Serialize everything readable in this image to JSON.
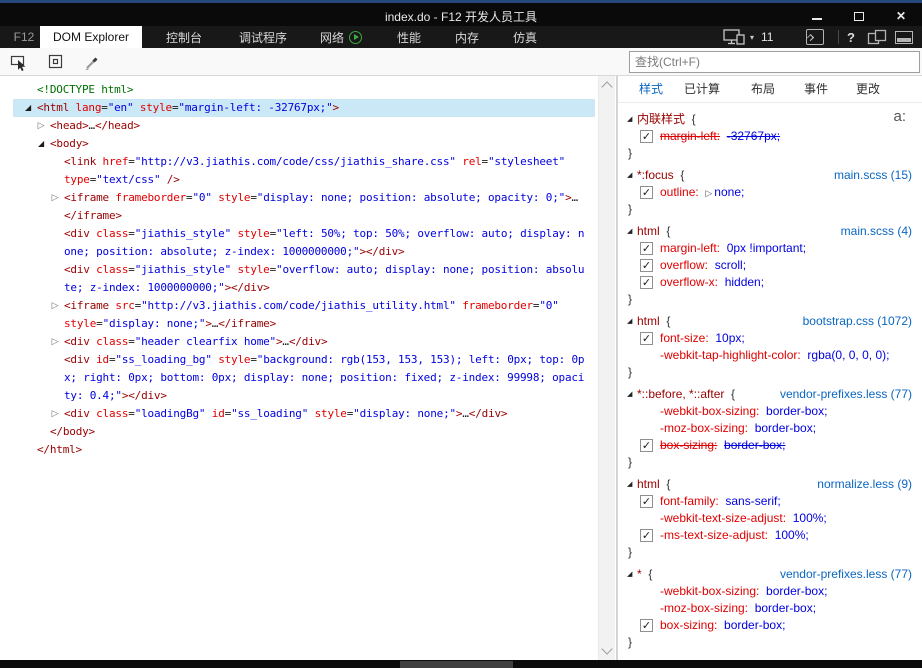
{
  "colors": {
    "accent_top_strip": "#26497c",
    "titlebar_bg": "#0a0a0a",
    "selection_bg": "#cbe8f6",
    "tag_color": "#990000",
    "attr_color": "#e00000",
    "value_color": "#0000e0",
    "doctype_color": "#007000",
    "link_color": "#0a66c2"
  },
  "icons": {
    "close": "✕",
    "help": "?",
    "doc_mode_caret": "▾",
    "tree_expanded": "◢",
    "tree_collapsed": "▷",
    "rule_expanded": "◢",
    "value_expander": "▷",
    "checkbox_check": "✓"
  },
  "window": {
    "title": "index.do - F12 开发人员工具"
  },
  "tab_bar": {
    "f12_label": "F12",
    "doc_mode": "11",
    "tabs": [
      {
        "name": "dom-explorer",
        "label": "DOM Explorer",
        "active": true
      },
      {
        "name": "console",
        "label": "控制台"
      },
      {
        "name": "debugger",
        "label": "调试程序"
      },
      {
        "name": "network",
        "label": "网络",
        "play_icon": true
      },
      {
        "name": "performance",
        "label": "性能"
      },
      {
        "name": "memory",
        "label": "内存"
      },
      {
        "name": "emulation",
        "label": "仿真"
      }
    ]
  },
  "toolbar": {
    "search_placeholder": "查找(Ctrl+F)"
  },
  "dom_tree": {
    "lines": [
      {
        "level": 0,
        "marker": null,
        "tokens": [
          [
            "d",
            "<!DOCTYPE html>"
          ]
        ]
      },
      {
        "level": 0,
        "marker": "exp",
        "selected": true,
        "tokens": [
          [
            "t",
            "<html "
          ],
          [
            "a",
            "lang"
          ],
          [
            "p",
            "="
          ],
          [
            "v",
            "\"en\""
          ],
          [
            "p",
            " "
          ],
          [
            "a",
            "style"
          ],
          [
            "p",
            "="
          ],
          [
            "v",
            "\"margin-left: -32767px;\""
          ],
          [
            "t",
            ">"
          ]
        ]
      },
      {
        "level": 1,
        "marker": "col",
        "tokens": [
          [
            "t",
            "<head>"
          ],
          [
            "p",
            "…"
          ],
          [
            "t",
            "</head>"
          ]
        ]
      },
      {
        "level": 1,
        "marker": "exp",
        "tokens": [
          [
            "t",
            "<body>"
          ]
        ]
      },
      {
        "level": 2,
        "marker": null,
        "tokens": [
          [
            "t",
            "<link "
          ],
          [
            "a",
            "href"
          ],
          [
            "p",
            "="
          ],
          [
            "v",
            "\"http://v3.jiathis.com/code/css/jiathis_share.css\""
          ],
          [
            "p",
            " "
          ],
          [
            "a",
            "rel"
          ],
          [
            "p",
            "="
          ],
          [
            "v",
            "\"stylesheet\""
          ]
        ]
      },
      {
        "level": 2,
        "marker": null,
        "tokens": [
          [
            "a",
            "type"
          ],
          [
            "p",
            "="
          ],
          [
            "v",
            "\"text/css\""
          ],
          [
            "t",
            " />"
          ]
        ]
      },
      {
        "level": 2,
        "marker": "col",
        "tokens": [
          [
            "t",
            "<iframe "
          ],
          [
            "a",
            "frameborder"
          ],
          [
            "p",
            "="
          ],
          [
            "v",
            "\"0\""
          ],
          [
            "p",
            " "
          ],
          [
            "a",
            "style"
          ],
          [
            "p",
            "="
          ],
          [
            "v",
            "\"display: none; position: absolute; opacity: 0;\""
          ],
          [
            "t",
            ">"
          ],
          [
            "p",
            "…"
          ]
        ]
      },
      {
        "level": 2,
        "marker": null,
        "tokens": [
          [
            "t",
            "</iframe>"
          ]
        ]
      },
      {
        "level": 2,
        "marker": null,
        "tokens": [
          [
            "t",
            "<div "
          ],
          [
            "a",
            "class"
          ],
          [
            "p",
            "="
          ],
          [
            "v",
            "\"jiathis_style\""
          ],
          [
            "p",
            " "
          ],
          [
            "a",
            "style"
          ],
          [
            "p",
            "="
          ],
          [
            "v",
            "\"left: 50%; top: 50%; overflow: auto; display: n"
          ]
        ]
      },
      {
        "level": 2,
        "marker": null,
        "tokens": [
          [
            "v",
            "one; position: absolute; z-index: 1000000000;\""
          ],
          [
            "t",
            "></div>"
          ]
        ]
      },
      {
        "level": 2,
        "marker": null,
        "tokens": [
          [
            "t",
            "<div "
          ],
          [
            "a",
            "class"
          ],
          [
            "p",
            "="
          ],
          [
            "v",
            "\"jiathis_style\""
          ],
          [
            "p",
            " "
          ],
          [
            "a",
            "style"
          ],
          [
            "p",
            "="
          ],
          [
            "v",
            "\"overflow: auto; display: none; position: absolu"
          ]
        ]
      },
      {
        "level": 2,
        "marker": null,
        "tokens": [
          [
            "v",
            "te; z-index: 1000000000;\""
          ],
          [
            "t",
            "></div>"
          ]
        ]
      },
      {
        "level": 2,
        "marker": "col",
        "tokens": [
          [
            "t",
            "<iframe "
          ],
          [
            "a",
            "src"
          ],
          [
            "p",
            "="
          ],
          [
            "v",
            "\"http://v3.jiathis.com/code/jiathis_utility.html\""
          ],
          [
            "p",
            " "
          ],
          [
            "a",
            "frameborder"
          ],
          [
            "p",
            "="
          ],
          [
            "v",
            "\"0\""
          ]
        ]
      },
      {
        "level": 2,
        "marker": null,
        "tokens": [
          [
            "a",
            "style"
          ],
          [
            "p",
            "="
          ],
          [
            "v",
            "\"display: none;\""
          ],
          [
            "t",
            ">"
          ],
          [
            "p",
            "…"
          ],
          [
            "t",
            "</iframe>"
          ]
        ]
      },
      {
        "level": 2,
        "marker": "col",
        "tokens": [
          [
            "t",
            "<div "
          ],
          [
            "a",
            "class"
          ],
          [
            "p",
            "="
          ],
          [
            "v",
            "\"header clearfix home\""
          ],
          [
            "t",
            ">"
          ],
          [
            "p",
            "…"
          ],
          [
            "t",
            "</div>"
          ]
        ]
      },
      {
        "level": 2,
        "marker": null,
        "tokens": [
          [
            "t",
            "<div "
          ],
          [
            "a",
            "id"
          ],
          [
            "p",
            "="
          ],
          [
            "v",
            "\"ss_loading_bg\""
          ],
          [
            "p",
            " "
          ],
          [
            "a",
            "style"
          ],
          [
            "p",
            "="
          ],
          [
            "v",
            "\"background: rgb(153, 153, 153); left: 0px; top: 0p"
          ]
        ]
      },
      {
        "level": 2,
        "marker": null,
        "tokens": [
          [
            "v",
            "x; right: 0px; bottom: 0px; display: none; position: fixed; z-index: 99998; opaci"
          ]
        ]
      },
      {
        "level": 2,
        "marker": null,
        "tokens": [
          [
            "v",
            "ty: 0.4;\""
          ],
          [
            "t",
            "></div>"
          ]
        ]
      },
      {
        "level": 2,
        "marker": "col",
        "tokens": [
          [
            "t",
            "<div "
          ],
          [
            "a",
            "class"
          ],
          [
            "p",
            "="
          ],
          [
            "v",
            "\"loadingBg\""
          ],
          [
            "p",
            " "
          ],
          [
            "a",
            "id"
          ],
          [
            "p",
            "="
          ],
          [
            "v",
            "\"ss_loading\""
          ],
          [
            "p",
            " "
          ],
          [
            "a",
            "style"
          ],
          [
            "p",
            "="
          ],
          [
            "v",
            "\"display: none;\""
          ],
          [
            "t",
            ">"
          ],
          [
            "p",
            "…"
          ],
          [
            "t",
            "</div>"
          ]
        ]
      },
      {
        "level": 1,
        "marker": null,
        "tokens": [
          [
            "t",
            "</body>"
          ]
        ]
      },
      {
        "level": 0,
        "marker": null,
        "tokens": [
          [
            "t",
            "</html>"
          ]
        ]
      }
    ]
  },
  "styles_panel": {
    "tabs": [
      {
        "name": "styles",
        "label": "样式",
        "active": true
      },
      {
        "name": "computed",
        "label": "已计算"
      },
      {
        "name": "layout",
        "label": "布局"
      },
      {
        "name": "events",
        "label": "事件"
      },
      {
        "name": "changes",
        "label": "更改"
      }
    ],
    "pseudo_state_button": "a:",
    "braces": {
      "open": "{",
      "close": "}"
    },
    "rules": [
      {
        "selector": "内联样式",
        "source": "",
        "props": [
          {
            "checked": true,
            "strike": true,
            "name": "margin-left:",
            "value": "-32767px;"
          }
        ]
      },
      {
        "selector": "*:focus",
        "source": "main.scss (15)",
        "props": [
          {
            "checked": true,
            "expand": true,
            "name": "outline:",
            "value": "none;"
          }
        ]
      },
      {
        "selector": "html",
        "source": "main.scss (4)",
        "props": [
          {
            "checked": true,
            "name": "margin-left:",
            "value": "0px !important;"
          },
          {
            "checked": true,
            "name": "overflow:",
            "value": "scroll;"
          },
          {
            "checked": true,
            "name": "overflow-x:",
            "value": "hidden;"
          }
        ]
      },
      {
        "selector": "html",
        "source": "bootstrap.css (1072)",
        "props": [
          {
            "checked": true,
            "name": "font-size:",
            "value": "10px;"
          },
          {
            "checked": false,
            "name": "-webkit-tap-highlight-color:",
            "value": "rgba(0, 0, 0, 0);"
          }
        ]
      },
      {
        "selector": "*::before, *::after",
        "source": "vendor-prefixes.less (77)",
        "props": [
          {
            "checked": false,
            "name": "-webkit-box-sizing:",
            "value": "border-box;"
          },
          {
            "checked": false,
            "name": "-moz-box-sizing:",
            "value": "border-box;"
          },
          {
            "checked": true,
            "strike": true,
            "name": "box-sizing:",
            "value": "border-box;"
          }
        ]
      },
      {
        "selector": "html",
        "source": "normalize.less (9)",
        "props": [
          {
            "checked": true,
            "name": "font-family:",
            "value": "sans-serif;"
          },
          {
            "checked": false,
            "name": "-webkit-text-size-adjust:",
            "value": "100%;"
          },
          {
            "checked": true,
            "name": "-ms-text-size-adjust:",
            "value": "100%;"
          }
        ]
      },
      {
        "selector": "*",
        "source": "vendor-prefixes.less (77)",
        "props": [
          {
            "checked": false,
            "name": "-webkit-box-sizing:",
            "value": "border-box;"
          },
          {
            "checked": false,
            "name": "-moz-box-sizing:",
            "value": "border-box;"
          },
          {
            "checked": true,
            "name": "box-sizing:",
            "value": "border-box;"
          }
        ]
      }
    ]
  }
}
